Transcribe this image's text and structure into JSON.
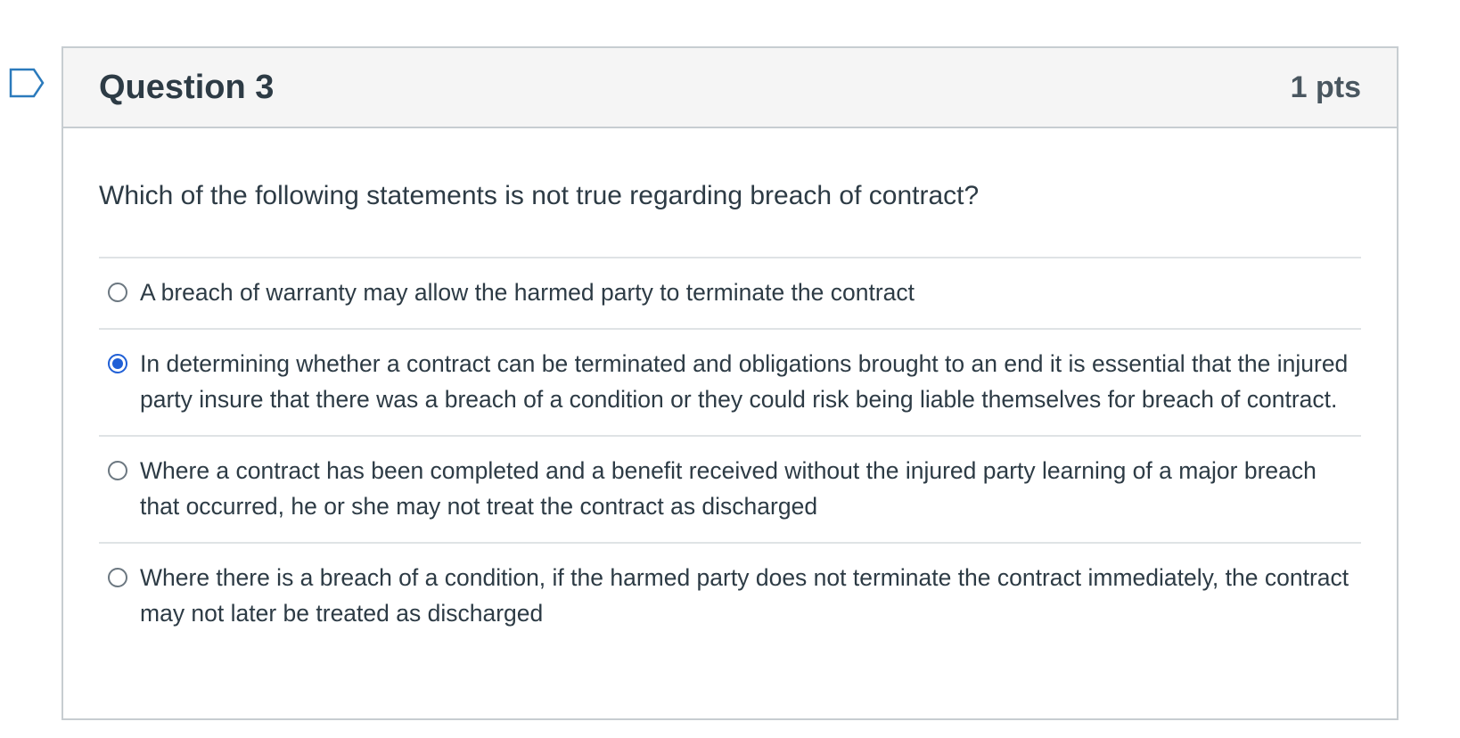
{
  "question": {
    "title": "Question 3",
    "points": "1 pts",
    "text": "Which of the following statements is not true regarding breach of contract?",
    "selected_index": 1,
    "answers": [
      {
        "label": "A breach of warranty may allow the harmed party to terminate the contract"
      },
      {
        "label": "In determining whether a contract can be terminated and obligations brought to an end it is essential that the injured party insure that there was a breach of a condition or they could risk being liable themselves for breach of contract."
      },
      {
        "label": "Where a contract has been completed and a benefit received without the injured party learning of a major breach that occurred, he or she may not treat the contract as discharged"
      },
      {
        "label": "Where there is a breach of a condition, if the harmed party does not terminate the contract immediately, the contract may not later be treated as discharged"
      }
    ]
  },
  "colors": {
    "selected_radio": "#1f5fd6",
    "header_bg": "#f5f5f5",
    "border": "#c7cdd1",
    "flag_outline": "#0770a3"
  },
  "icons": {
    "flag": "bookmark-flag-icon"
  }
}
